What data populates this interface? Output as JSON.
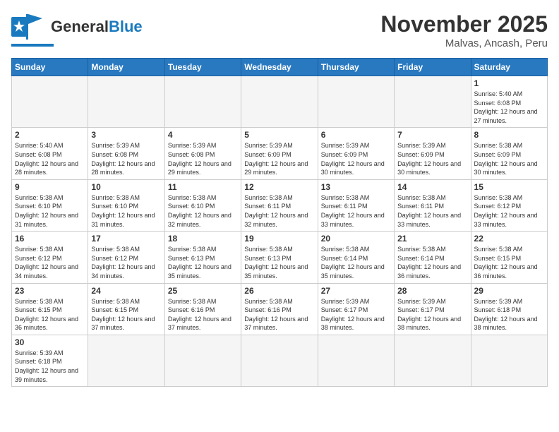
{
  "header": {
    "logo_general": "General",
    "logo_blue": "Blue",
    "title": "November 2025",
    "location": "Malvas, Ancash, Peru"
  },
  "days_of_week": [
    "Sunday",
    "Monday",
    "Tuesday",
    "Wednesday",
    "Thursday",
    "Friday",
    "Saturday"
  ],
  "weeks": [
    [
      {
        "day": "",
        "empty": true
      },
      {
        "day": "",
        "empty": true
      },
      {
        "day": "",
        "empty": true
      },
      {
        "day": "",
        "empty": true
      },
      {
        "day": "",
        "empty": true
      },
      {
        "day": "",
        "empty": true
      },
      {
        "day": "1",
        "sunrise": "5:40 AM",
        "sunset": "6:08 PM",
        "daylight": "12 hours and 27 minutes."
      }
    ],
    [
      {
        "day": "2",
        "sunrise": "5:40 AM",
        "sunset": "6:08 PM",
        "daylight": "12 hours and 28 minutes."
      },
      {
        "day": "3",
        "sunrise": "5:39 AM",
        "sunset": "6:08 PM",
        "daylight": "12 hours and 28 minutes."
      },
      {
        "day": "4",
        "sunrise": "5:39 AM",
        "sunset": "6:08 PM",
        "daylight": "12 hours and 29 minutes."
      },
      {
        "day": "5",
        "sunrise": "5:39 AM",
        "sunset": "6:09 PM",
        "daylight": "12 hours and 29 minutes."
      },
      {
        "day": "6",
        "sunrise": "5:39 AM",
        "sunset": "6:09 PM",
        "daylight": "12 hours and 30 minutes."
      },
      {
        "day": "7",
        "sunrise": "5:39 AM",
        "sunset": "6:09 PM",
        "daylight": "12 hours and 30 minutes."
      },
      {
        "day": "8",
        "sunrise": "5:38 AM",
        "sunset": "6:09 PM",
        "daylight": "12 hours and 30 minutes."
      }
    ],
    [
      {
        "day": "9",
        "sunrise": "5:38 AM",
        "sunset": "6:10 PM",
        "daylight": "12 hours and 31 minutes."
      },
      {
        "day": "10",
        "sunrise": "5:38 AM",
        "sunset": "6:10 PM",
        "daylight": "12 hours and 31 minutes."
      },
      {
        "day": "11",
        "sunrise": "5:38 AM",
        "sunset": "6:10 PM",
        "daylight": "12 hours and 32 minutes."
      },
      {
        "day": "12",
        "sunrise": "5:38 AM",
        "sunset": "6:11 PM",
        "daylight": "12 hours and 32 minutes."
      },
      {
        "day": "13",
        "sunrise": "5:38 AM",
        "sunset": "6:11 PM",
        "daylight": "12 hours and 33 minutes."
      },
      {
        "day": "14",
        "sunrise": "5:38 AM",
        "sunset": "6:11 PM",
        "daylight": "12 hours and 33 minutes."
      },
      {
        "day": "15",
        "sunrise": "5:38 AM",
        "sunset": "6:12 PM",
        "daylight": "12 hours and 33 minutes."
      }
    ],
    [
      {
        "day": "16",
        "sunrise": "5:38 AM",
        "sunset": "6:12 PM",
        "daylight": "12 hours and 34 minutes."
      },
      {
        "day": "17",
        "sunrise": "5:38 AM",
        "sunset": "6:12 PM",
        "daylight": "12 hours and 34 minutes."
      },
      {
        "day": "18",
        "sunrise": "5:38 AM",
        "sunset": "6:13 PM",
        "daylight": "12 hours and 35 minutes."
      },
      {
        "day": "19",
        "sunrise": "5:38 AM",
        "sunset": "6:13 PM",
        "daylight": "12 hours and 35 minutes."
      },
      {
        "day": "20",
        "sunrise": "5:38 AM",
        "sunset": "6:14 PM",
        "daylight": "12 hours and 35 minutes."
      },
      {
        "day": "21",
        "sunrise": "5:38 AM",
        "sunset": "6:14 PM",
        "daylight": "12 hours and 36 minutes."
      },
      {
        "day": "22",
        "sunrise": "5:38 AM",
        "sunset": "6:15 PM",
        "daylight": "12 hours and 36 minutes."
      }
    ],
    [
      {
        "day": "23",
        "sunrise": "5:38 AM",
        "sunset": "6:15 PM",
        "daylight": "12 hours and 36 minutes."
      },
      {
        "day": "24",
        "sunrise": "5:38 AM",
        "sunset": "6:15 PM",
        "daylight": "12 hours and 37 minutes."
      },
      {
        "day": "25",
        "sunrise": "5:38 AM",
        "sunset": "6:16 PM",
        "daylight": "12 hours and 37 minutes."
      },
      {
        "day": "26",
        "sunrise": "5:38 AM",
        "sunset": "6:16 PM",
        "daylight": "12 hours and 37 minutes."
      },
      {
        "day": "27",
        "sunrise": "5:39 AM",
        "sunset": "6:17 PM",
        "daylight": "12 hours and 38 minutes."
      },
      {
        "day": "28",
        "sunrise": "5:39 AM",
        "sunset": "6:17 PM",
        "daylight": "12 hours and 38 minutes."
      },
      {
        "day": "29",
        "sunrise": "5:39 AM",
        "sunset": "6:18 PM",
        "daylight": "12 hours and 38 minutes."
      }
    ],
    [
      {
        "day": "30",
        "sunrise": "5:39 AM",
        "sunset": "6:18 PM",
        "daylight": "12 hours and 39 minutes."
      },
      {
        "day": "",
        "empty": true
      },
      {
        "day": "",
        "empty": true
      },
      {
        "day": "",
        "empty": true
      },
      {
        "day": "",
        "empty": true
      },
      {
        "day": "",
        "empty": true
      },
      {
        "day": "",
        "empty": true
      }
    ]
  ],
  "labels": {
    "sunrise": "Sunrise:",
    "sunset": "Sunset:",
    "daylight": "Daylight:"
  }
}
